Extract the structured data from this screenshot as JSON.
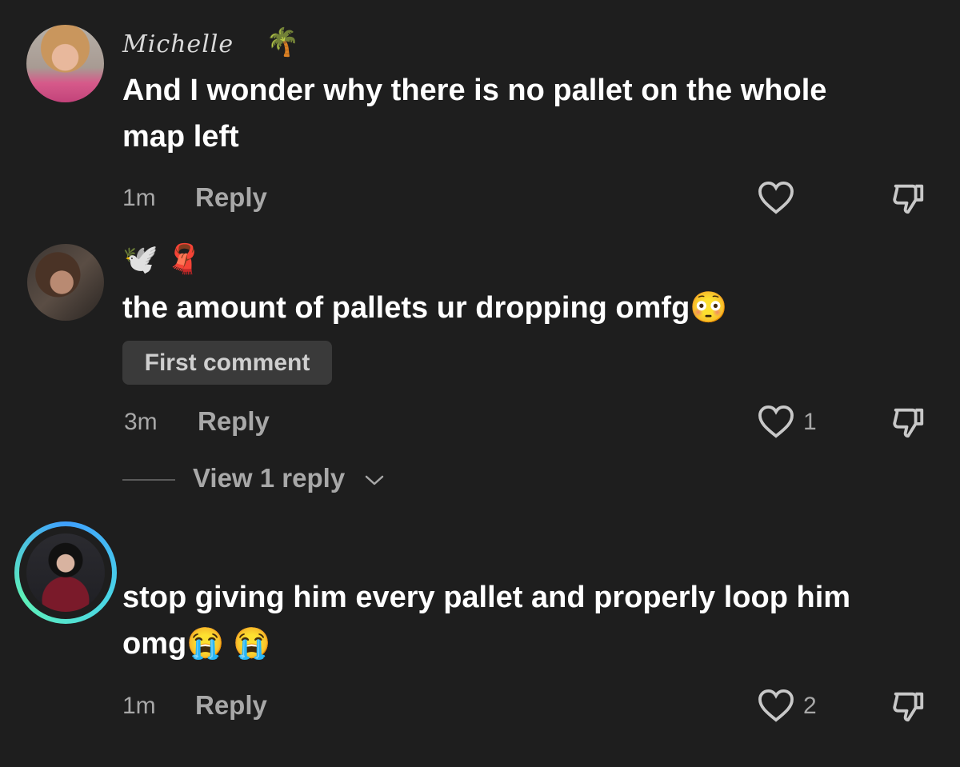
{
  "comments": [
    {
      "username": "Michelle",
      "username_emoji": "🌴",
      "text_lines": [
        "And I wonder why there is no pallet on the whole",
        "map left"
      ],
      "time": "1m",
      "reply_label": "Reply",
      "likes": ""
    },
    {
      "username_emoji": "🕊️ 🧣",
      "text": "the amount of pallets ur dropping omfg",
      "text_emoji": "😳",
      "badge": "First comment",
      "time": "3m",
      "reply_label": "Reply",
      "likes": "1",
      "view_replies": "View 1 reply"
    },
    {
      "text_lines": [
        "stop giving him every pallet and properly loop him",
        "omg"
      ],
      "text_emoji": "😭 😭",
      "time": "1m",
      "reply_label": "Reply",
      "likes": "2"
    }
  ],
  "icons": {
    "like": "heart-outline-icon",
    "dislike": "thumbs-down-icon",
    "expand": "chevron-down-icon"
  },
  "colors": {
    "background": "#1e1e1e",
    "text": "#ffffff",
    "muted": "#a8a8a8",
    "badge_bg": "#3a3a3a",
    "story_ring": "#4ad6e6"
  }
}
